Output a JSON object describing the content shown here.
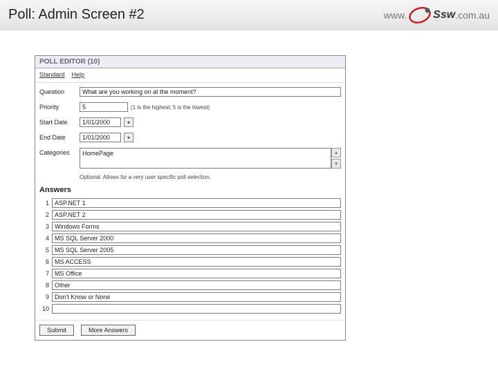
{
  "slide": {
    "title": "Poll: Admin Screen #2",
    "logo_www": "www.",
    "logo_text": "Ssw",
    "logo_tld": ".com.au"
  },
  "editor": {
    "title": "POLL EDITOR (10)",
    "tabs": {
      "standard": "Standard",
      "help": "Help"
    },
    "labels": {
      "question": "Question",
      "priority": "Priority",
      "start_date": "Start Date",
      "end_date": "End Date",
      "categories": "Categories"
    },
    "values": {
      "question": "What are you working on at the moment?",
      "priority": "5",
      "priority_note": "(1 is the highest; 5 is the lowest)",
      "start_date": "1/01/2000",
      "end_date": "1/01/2000",
      "categories": "HomePage",
      "categories_note": "Optional. Allows for a very user specific poll selection."
    },
    "answers_heading": "Answers",
    "answers": [
      {
        "n": "1",
        "text": "ASP.NET 1"
      },
      {
        "n": "2",
        "text": "ASP.NET 2"
      },
      {
        "n": "3",
        "text": "Windows Forms"
      },
      {
        "n": "4",
        "text": "MS SQL Server 2000"
      },
      {
        "n": "5",
        "text": "MS SQL Server 2005"
      },
      {
        "n": "6",
        "text": "MS ACCESS"
      },
      {
        "n": "7",
        "text": "MS Office"
      },
      {
        "n": "8",
        "text": "Other"
      },
      {
        "n": "9",
        "text": "Don't Know or None"
      },
      {
        "n": "10",
        "text": ""
      }
    ],
    "buttons": {
      "submit": "Submit",
      "more": "More Answers"
    }
  }
}
